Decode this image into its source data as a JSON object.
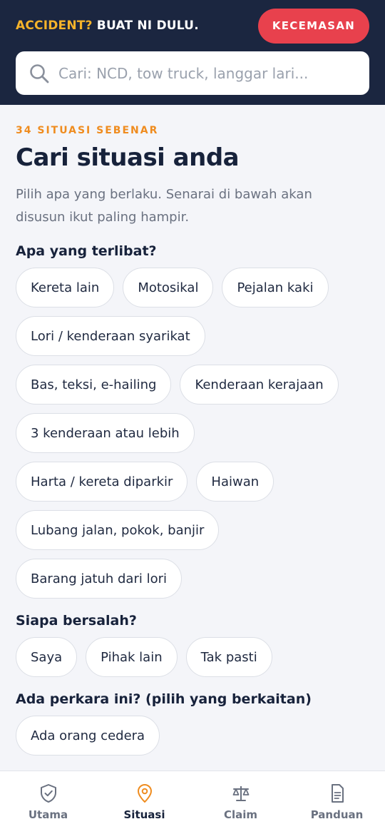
{
  "header": {
    "title_accent": "ACCIDENT?",
    "title_rest": "BUAT NI DULU.",
    "emergency_label": "KECEMASAN"
  },
  "search": {
    "placeholder": "Cari: NCD, tow truck, langgar lari...",
    "value": "",
    "icon": "search-icon"
  },
  "main": {
    "eyebrow": "34 SITUASI SEBENAR",
    "title": "Cari situasi anda",
    "intro": "Pilih apa yang berlaku. Senarai di bawah akan disusun ikut paling hampir."
  },
  "filters": {
    "involved": {
      "title": "Apa yang terlibat?",
      "chips": [
        "Kereta lain",
        "Motosikal",
        "Pejalan kaki",
        "Lori / kenderaan syarikat",
        "Bas, teksi, e-hailing",
        "Kenderaan kerajaan",
        "3 kenderaan atau lebih",
        "Harta / kereta diparkir",
        "Haiwan",
        "Lubang jalan, pokok, banjir",
        "Barang jatuh dari lori"
      ]
    },
    "fault": {
      "title": "Siapa bersalah?",
      "chips": [
        "Saya",
        "Pihak lain",
        "Tak pasti"
      ]
    },
    "issues": {
      "title": "Ada perkara ini? (pilih yang berkaitan)",
      "chips": [
        "Ada orang cedera"
      ]
    }
  },
  "nav": {
    "items": [
      {
        "label": "Utama",
        "icon": "shield-check-icon",
        "active": false
      },
      {
        "label": "Situasi",
        "icon": "map-pin-icon",
        "active": true
      },
      {
        "label": "Claim",
        "icon": "scale-icon",
        "active": false
      },
      {
        "label": "Panduan",
        "icon": "document-icon",
        "active": false
      }
    ]
  },
  "colors": {
    "header_bg": "#1b2640",
    "accent_yellow": "#f5b32a",
    "emergency_red": "#e8414d",
    "eyebrow_orange": "#ef8c1f",
    "active_nav_orange": "#ef8c1f",
    "nav_inactive": "#6a7180"
  }
}
